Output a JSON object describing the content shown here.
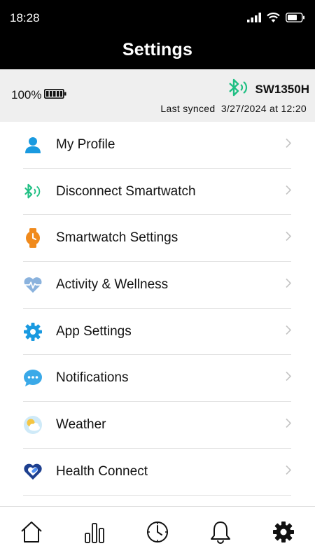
{
  "status_bar": {
    "time": "18:28",
    "icons": [
      "cellular-signal-icon",
      "wifi-icon",
      "battery-icon"
    ]
  },
  "header": {
    "title": "Settings"
  },
  "device": {
    "battery_percent": "100%",
    "name": "SW1350H",
    "last_synced_label": "Last synced",
    "last_synced_value": "3/27/2024 at 12:20",
    "connection_color": "#1fbf83"
  },
  "menu": {
    "items": [
      {
        "label": "My Profile",
        "icon": "profile-icon",
        "color": "#1a9ae0"
      },
      {
        "label": "Disconnect Smartwatch",
        "icon": "bluetooth-icon",
        "color": "#1fbf83"
      },
      {
        "label": "Smartwatch Settings",
        "icon": "watch-icon",
        "color": "#f08a1c"
      },
      {
        "label": "Activity & Wellness",
        "icon": "heart-pulse-icon",
        "color": "#5a8fc8"
      },
      {
        "label": "App Settings",
        "icon": "gear-icon",
        "color": "#1a9ae0"
      },
      {
        "label": "Notifications",
        "icon": "chat-bubble-icon",
        "color": "#1a9ae0"
      },
      {
        "label": "Weather",
        "icon": "weather-icon",
        "color": "#f5c542"
      },
      {
        "label": "Health Connect",
        "icon": "health-connect-icon",
        "color": "#2f6fd6"
      }
    ]
  },
  "bottom_nav": {
    "items": [
      {
        "icon": "home-icon"
      },
      {
        "icon": "bar-chart-icon"
      },
      {
        "icon": "clock-icon"
      },
      {
        "icon": "bell-icon"
      },
      {
        "icon": "settings-icon",
        "active": true
      }
    ]
  }
}
